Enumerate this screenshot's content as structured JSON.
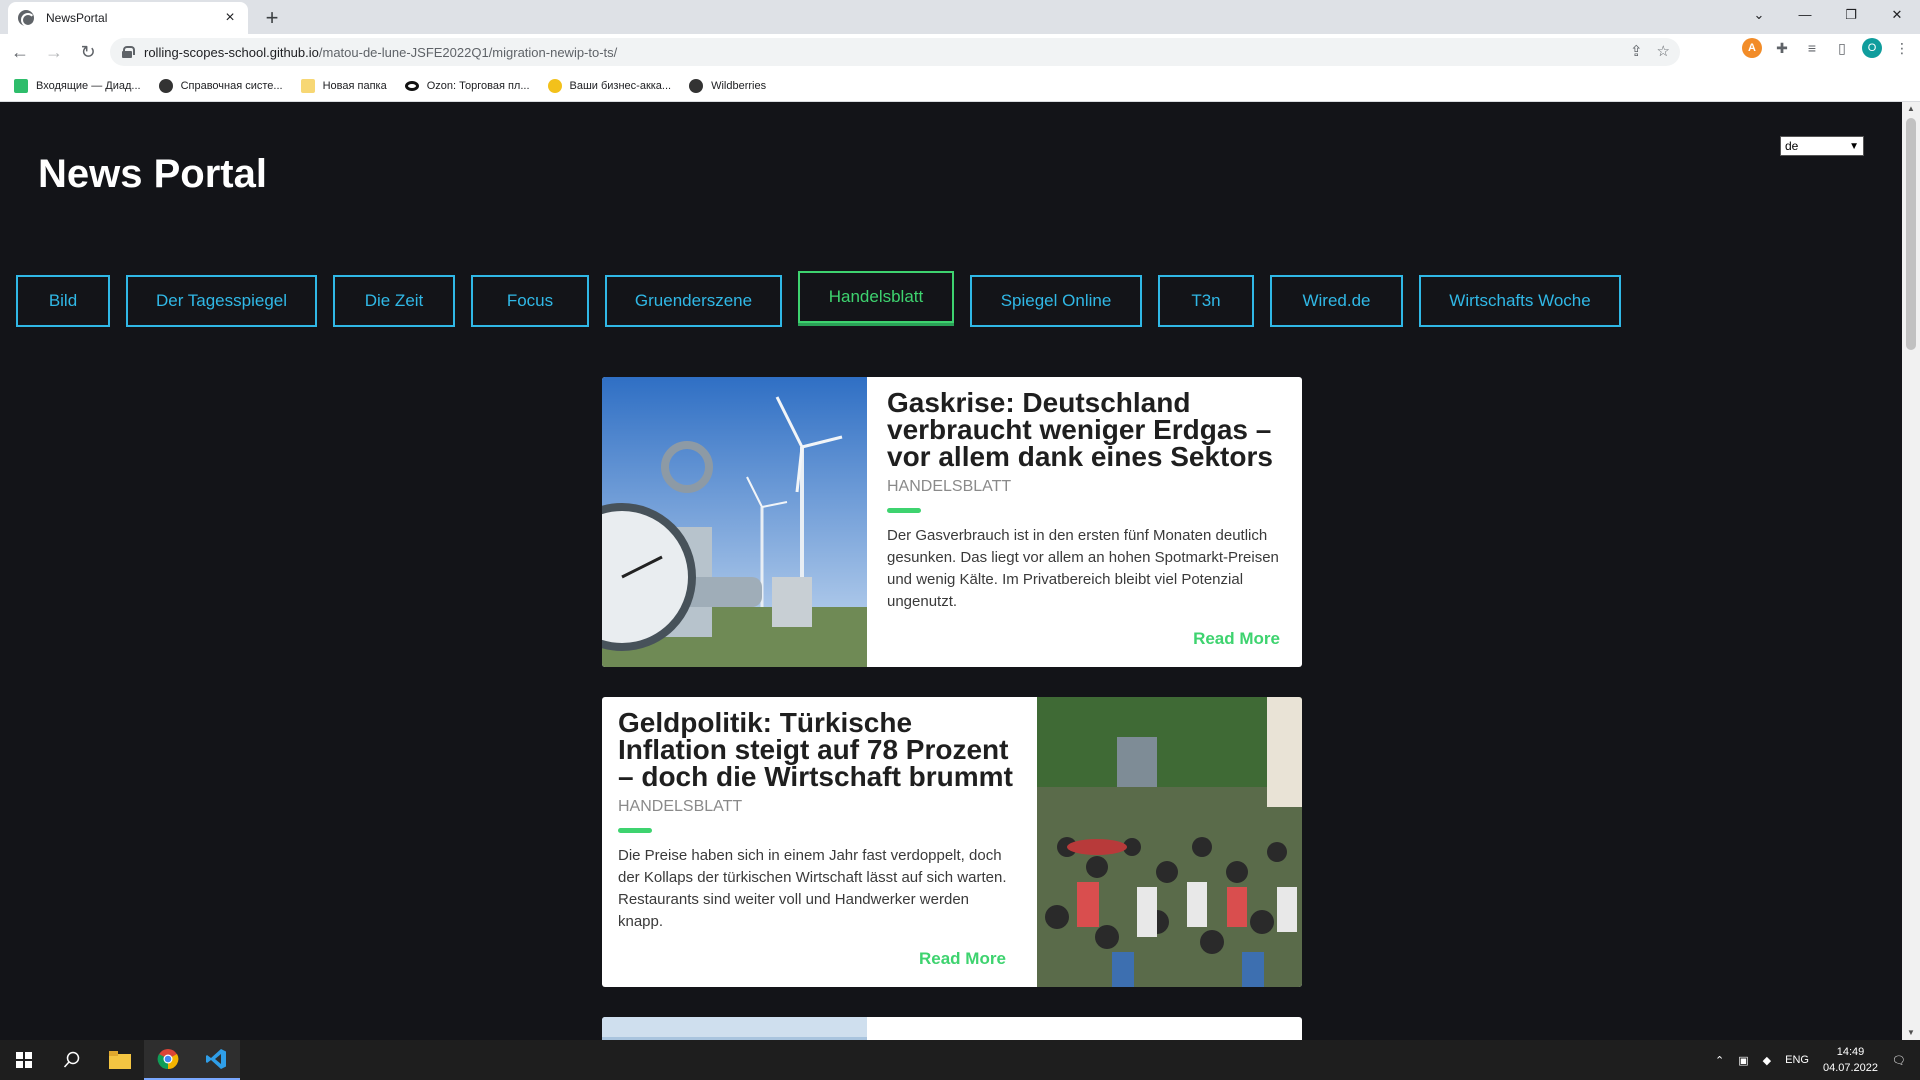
{
  "browser": {
    "tab_title": "NewsPortal",
    "url_host": "rolling-scopes-school.github.io",
    "url_path": "/matou-de-lune-JSFE2022Q1/migration-newip-to-ts/",
    "new_tab_label": "+",
    "bookmarks": [
      {
        "label": "Входящие — Диад...",
        "icon": "diadoc-icon"
      },
      {
        "label": "Справочная систе...",
        "icon": "globe-icon"
      },
      {
        "label": "Новая папка",
        "icon": "folder-icon"
      },
      {
        "label": "Ozon: Торговая пл...",
        "icon": "ozon-icon"
      },
      {
        "label": "Ваши бизнес-акка...",
        "icon": "business-icon"
      },
      {
        "label": "Wildberries",
        "icon": "globe-icon"
      }
    ],
    "profile_initial": "O"
  },
  "page": {
    "site_title": "News Portal",
    "language": "de",
    "sources": [
      {
        "label": "Bild",
        "active": false
      },
      {
        "label": "Der Tagesspiegel",
        "active": false
      },
      {
        "label": "Die Zeit",
        "active": false
      },
      {
        "label": "Focus",
        "active": false
      },
      {
        "label": "Gruenderszene",
        "active": false
      },
      {
        "label": "Handelsblatt",
        "active": true
      },
      {
        "label": "Spiegel Online",
        "active": false
      },
      {
        "label": "T3n",
        "active": false
      },
      {
        "label": "Wired.de",
        "active": false
      },
      {
        "label": "Wirtschafts Woche",
        "active": false
      }
    ],
    "articles": [
      {
        "title": "Gaskrise: Deutschland verbraucht weniger Erdgas – vor allem dank eines Sektors",
        "source": "HANDELSBLATT",
        "description": "Der Gasverbrauch ist in den ersten fünf Monaten deutlich gesunken. Das liegt vor allem an hohen Spotmarkt-Preisen und wenig Kälte. Im Privatbereich bleibt viel Potenzial ungenutzt.",
        "read_more": "Read More"
      },
      {
        "title": "Geldpolitik: Türkische Inflation steigt auf 78 Prozent – doch die Wirtschaft brummt",
        "source": "HANDELSBLATT",
        "description": "Die Preise haben sich in einem Jahr fast verdoppelt, doch der Kollaps der türkischen Wirtschaft lässt auf sich warten. Restaurants sind weiter voll und Handwerker werden knapp.",
        "read_more": "Read More"
      }
    ]
  },
  "taskbar": {
    "language": "ENG",
    "time": "14:49",
    "date": "04.07.2022"
  },
  "colors": {
    "page_bg": "#131418",
    "source_border": "#30b8e6",
    "active_source": "#3ed36f",
    "accent_green": "#3ed36f"
  }
}
